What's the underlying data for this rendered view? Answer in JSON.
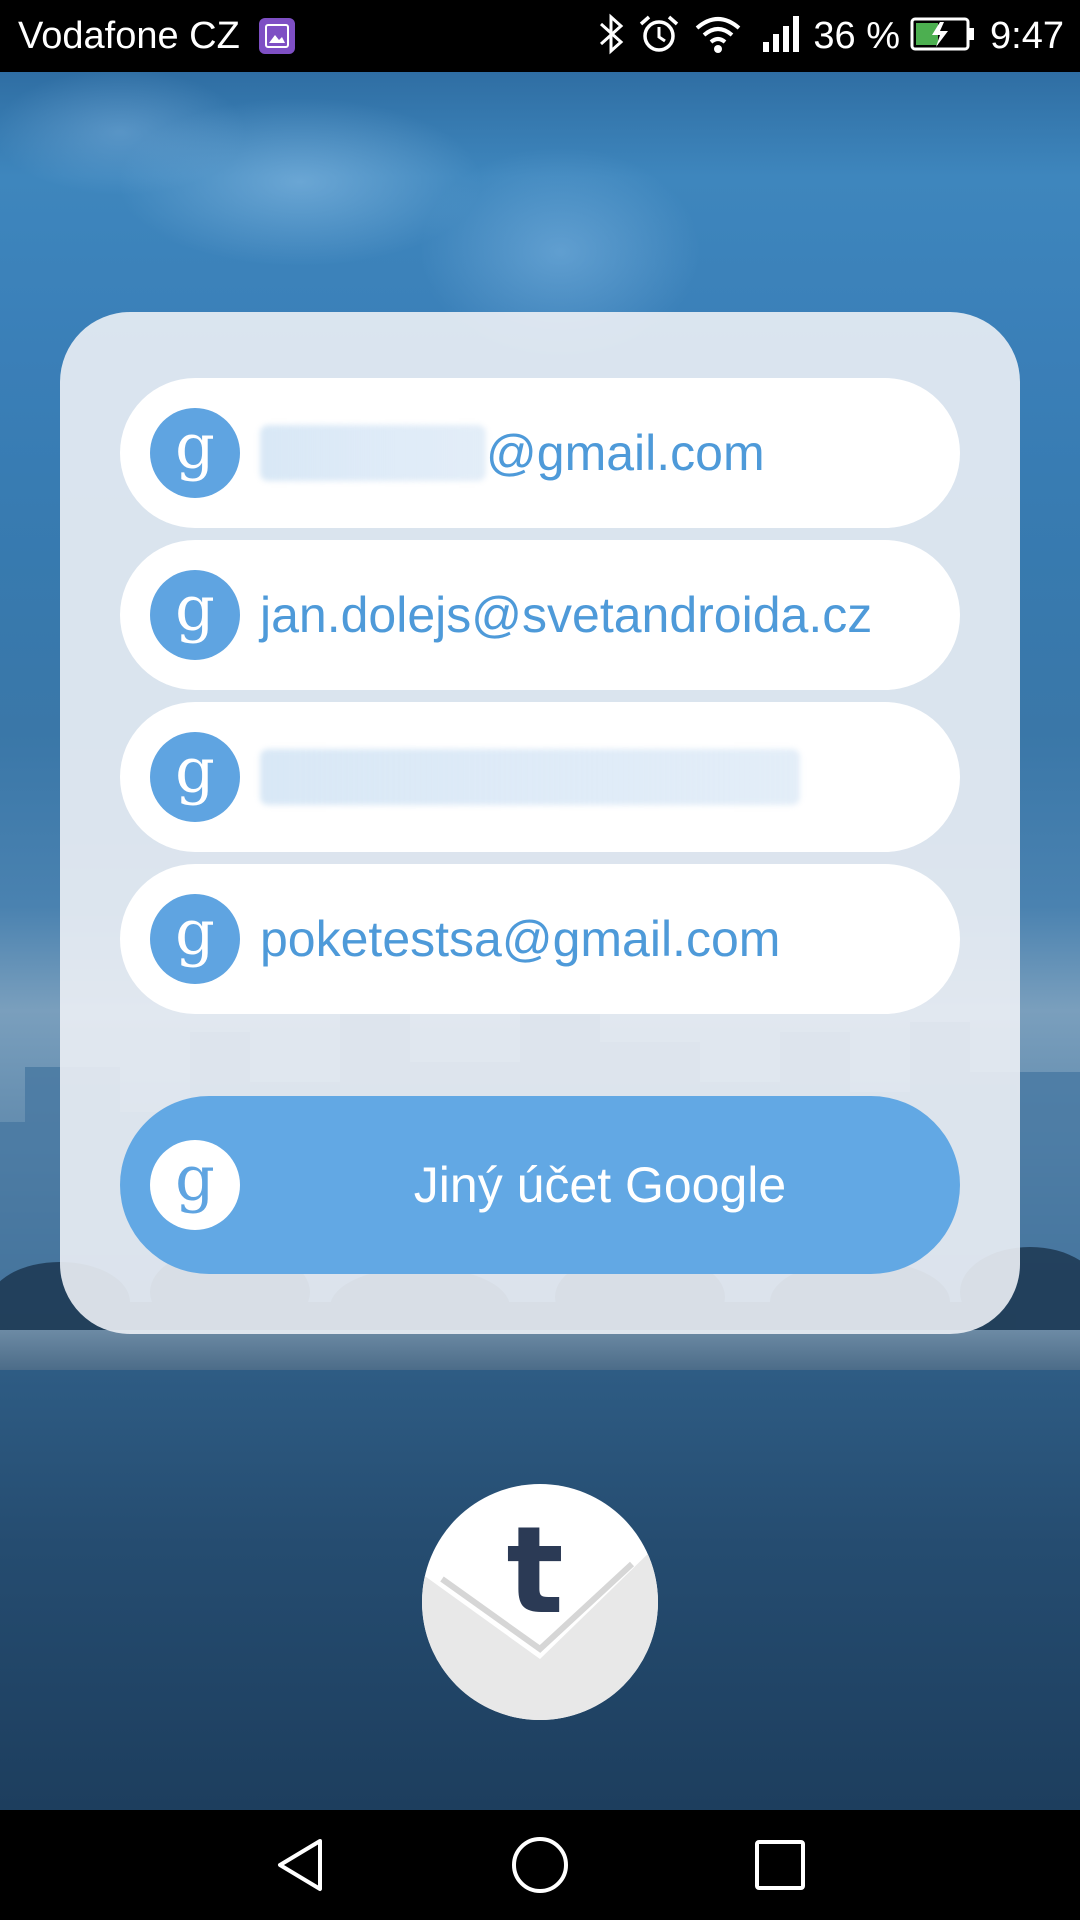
{
  "status_bar": {
    "carrier": "Vodafone CZ",
    "battery_percent": "36 %",
    "time": "9:47",
    "icons": [
      "gallery-notification-icon",
      "bluetooth-icon",
      "alarm-icon",
      "wifi-icon",
      "signal-icon",
      "battery-charging-icon"
    ]
  },
  "accounts": [
    {
      "prefix_redacted": true,
      "domain": "@gmail.com",
      "icon": "google-g-icon"
    },
    {
      "email": "jan.dolejs@svetandroida.cz",
      "icon": "google-g-icon"
    },
    {
      "redacted": true,
      "icon": "google-g-icon"
    },
    {
      "email": "poketestsa@gmail.com",
      "icon": "google-g-icon"
    }
  ],
  "other_account_button": {
    "label": "Jiný účet Google",
    "icon": "google-g-icon"
  },
  "google_glyph": "g",
  "app_logo": {
    "letter": "t",
    "icon": "tumblr-mail-logo"
  },
  "nav_bar": {
    "buttons": [
      "back-icon",
      "home-icon",
      "recents-icon"
    ]
  },
  "colors": {
    "accent": "#62a8e4",
    "email_text": "#4e9ad9",
    "card": "#ecf0f5"
  }
}
